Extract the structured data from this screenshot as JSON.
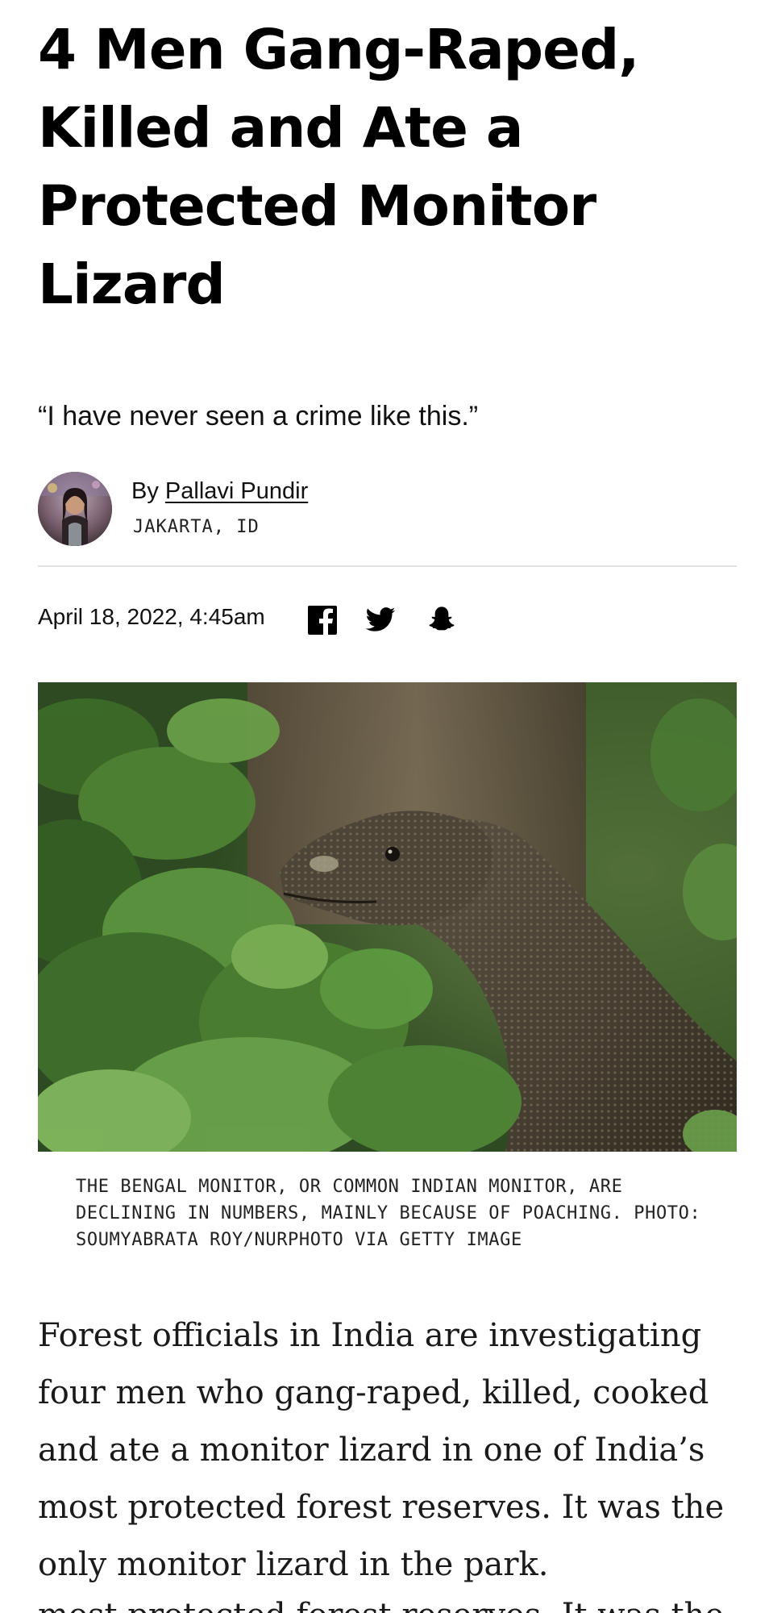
{
  "article": {
    "headline": "4 Men Gang-Raped, Killed and Ate a Protected Monitor Lizard",
    "dek": "“I have never seen a crime like this.”",
    "byline": {
      "prefix": "By",
      "author": "Pallavi Pundir",
      "dateline": "JAKARTA, ID"
    },
    "published": "April 18, 2022, 4:45am",
    "share_icons": [
      "facebook-icon",
      "twitter-icon",
      "snapchat-icon"
    ],
    "hero_image": {
      "subject": "bengal-monitor-lizard-photo",
      "caption": "THE BENGAL MONITOR, OR COMMON INDIAN MONITOR, ARE DECLINING IN NUMBERS, MAINLY BECAUSE OF POACHING. PHOTO: SOUMYABRATA ROY/NURPHOTO VIA GETTY IMAGE"
    },
    "body": {
      "paragraph_1": "Forest officials in India are investigating four men who gang-raped, killed, cooked and ate a monitor lizard in one of India’s most protected forest reserves. It was the only monitor lizard in the park.",
      "cut_off_line": "most protected forest reserves. It was the"
    }
  },
  "colors": {
    "text": "#000000",
    "divider": "#e3e3e3",
    "foliage": "#3f6b2c",
    "lizard": "#4a4336"
  }
}
